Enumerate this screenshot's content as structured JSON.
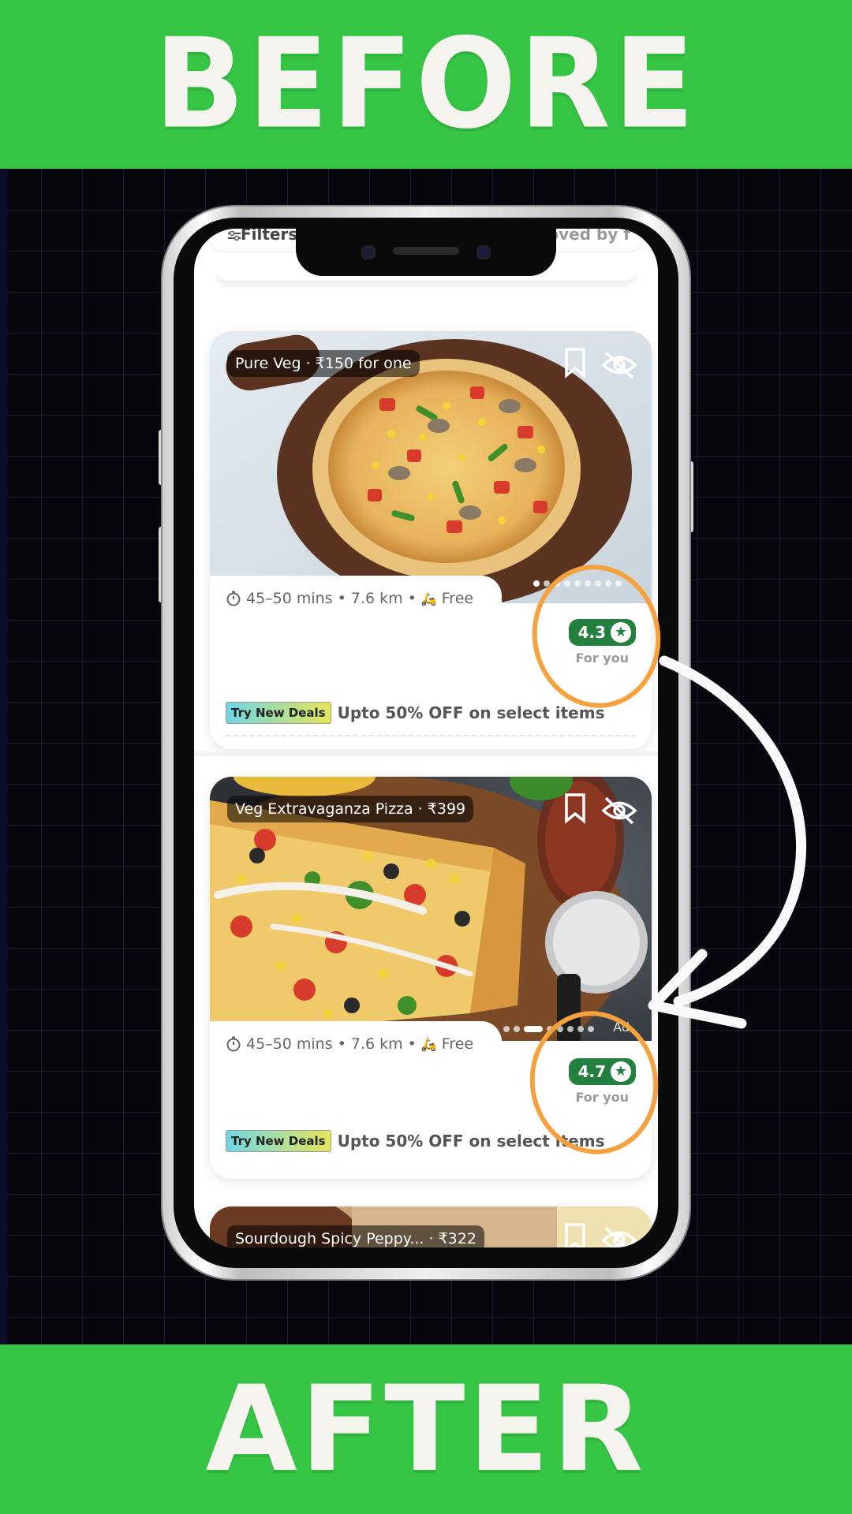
{
  "banners": {
    "top": "BEFORE",
    "bottom": "AFTER"
  },
  "app": {
    "filters_label": "Filters",
    "loved_label": "oved by f"
  },
  "cards": [
    {
      "tag": "Pure Veg · ₹150 for one",
      "meta": "45–50 mins • 7.6 km • ⛟ Free",
      "meta_time": "45–50 mins",
      "meta_distance": "7.6 km",
      "meta_delivery": "Free",
      "rating": "4.3",
      "rating_sub": "For you",
      "deal_tag": "Try New Deals",
      "deal_text": "Upto 50% OFF on select items",
      "photo_colors": [
        "#dfe6ec",
        "#5b3421"
      ]
    },
    {
      "tag": "Veg Extravaganza Pizza · ₹399",
      "meta_time": "45–50 mins",
      "meta_distance": "7.6 km",
      "meta_delivery": "Free",
      "ad_label": "Ad",
      "rating": "4.7",
      "rating_sub": "For you",
      "deal_tag": "Try New Deals",
      "deal_text": "Upto 50% OFF on select items"
    },
    {
      "tag": "Sourdough Spicy Peppy...   · ₹322"
    }
  ],
  "colors": {
    "banner_green": "#35c443",
    "rating_green": "#24803f",
    "highlight_orange": "#f5a13e"
  },
  "icons": [
    "filter-icon",
    "bookmark-icon",
    "hide-icon",
    "clock-icon",
    "scooter-icon",
    "star-icon",
    "curved-arrow-icon"
  ]
}
